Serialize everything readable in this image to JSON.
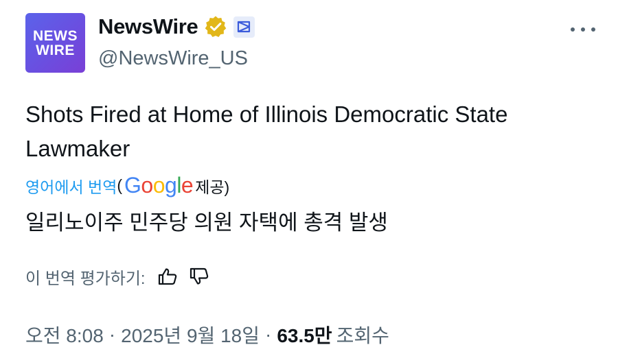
{
  "account": {
    "avatar_line1": "NEWS",
    "avatar_line2": "WIRE",
    "display_name": "NewsWire",
    "handle": "@NewsWire_US",
    "verified_badge": "gold-checkmark-icon",
    "affiliate_badge": "affiliate-logo-icon"
  },
  "tweet": {
    "text": "Shots Fired at Home of Illinois Democratic State Lawmaker"
  },
  "translation": {
    "translated_from": "영어에서 번역",
    "paren_open": "(",
    "provider_letters": [
      "G",
      "o",
      "o",
      "g",
      "l",
      "e"
    ],
    "provided_by": "제공)",
    "text": "일리노이주 민주당 의원 자택에 총격 발생",
    "rate_label": "이 번역 평가하기:"
  },
  "meta": {
    "time": "오전 8:08",
    "sep1": "·",
    "date": "2025년 9월 18일",
    "sep2": "·",
    "views_count": "63.5만",
    "views_label": "조회수"
  },
  "colors": {
    "link": "#1d9bf0",
    "secondary": "#536471",
    "gold": "#e2b719",
    "avatar": "#6a4fe0"
  }
}
